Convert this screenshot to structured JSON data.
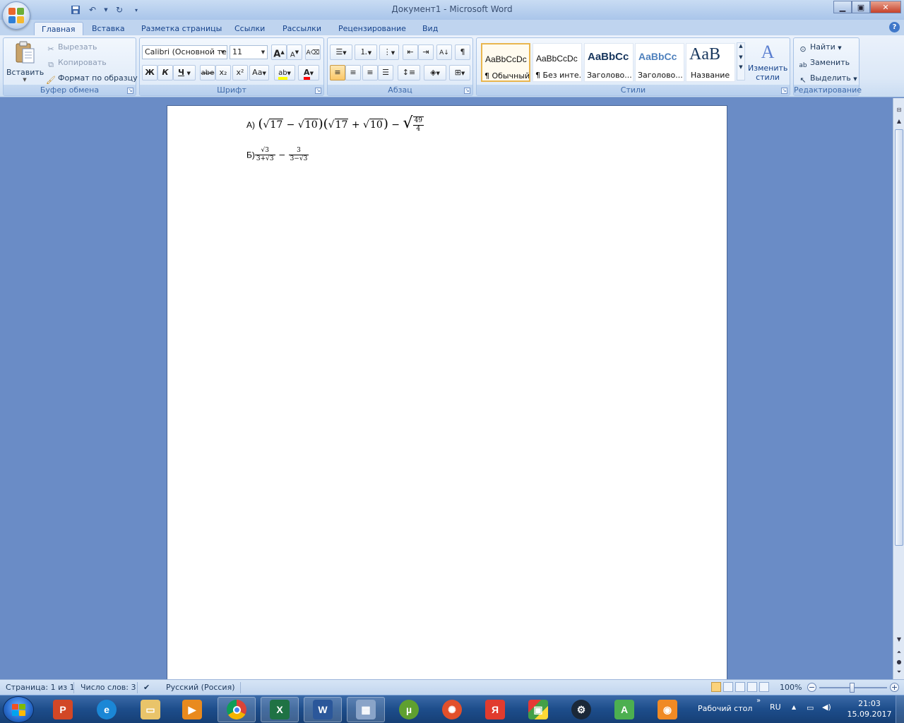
{
  "window": {
    "title": "Документ1 - Microsoft Word"
  },
  "tabs": [
    {
      "label": "Главная",
      "active": true
    },
    {
      "label": "Вставка"
    },
    {
      "label": "Разметка страницы"
    },
    {
      "label": "Ссылки"
    },
    {
      "label": "Рассылки"
    },
    {
      "label": "Рецензирование"
    },
    {
      "label": "Вид"
    }
  ],
  "ribbon": {
    "clipboard": {
      "label": "Буфер обмена",
      "paste": "Вставить",
      "cut": "Вырезать",
      "copy": "Копировать",
      "format_painter": "Формат по образцу"
    },
    "font": {
      "label": "Шрифт",
      "font_name": "Calibri (Основной те",
      "font_size": "11",
      "bold": "Ж",
      "italic": "К",
      "underline": "Ч",
      "strike": "abe",
      "subscript": "x₂",
      "superscript": "x²",
      "change_case": "Aa",
      "grow": "A",
      "shrink": "A",
      "highlight_color": "#ffff00",
      "font_color": "#ff0000"
    },
    "paragraph": {
      "label": "Абзац"
    },
    "styles": {
      "label": "Стили",
      "items": [
        {
          "sample": "AaBbCcDc",
          "name": "¶ Обычный",
          "selected": true
        },
        {
          "sample": "AaBbCcDc",
          "name": "¶ Без инте..."
        },
        {
          "sample": "AaBbCc",
          "name": "Заголово..."
        },
        {
          "sample": "AaBbCc",
          "name": "Заголово..."
        },
        {
          "sample": "AaB",
          "name": "Название"
        }
      ],
      "change_styles": "Изменить стили"
    },
    "editing": {
      "label": "Редактирование",
      "find": "Найти",
      "replace": "Заменить",
      "select": "Выделить"
    }
  },
  "document": {
    "line_a": {
      "label": "А)",
      "a1": "17",
      "b1": "10",
      "a2": "17",
      "b2": "10",
      "frac_num": "49",
      "frac_den": "4"
    },
    "line_b": {
      "label": "Б)",
      "num1": "√3",
      "den1": "3+√3",
      "num2": "3",
      "den2": "3−√3"
    }
  },
  "statusbar": {
    "page": "Страница: 1 из 1",
    "words": "Число слов: 3",
    "language": "Русский (Россия)",
    "zoom": "100%"
  },
  "taskbar": {
    "desktop_label": "Рабочий стол",
    "lang": "RU",
    "time": "21:03",
    "date": "15.09.2017"
  }
}
